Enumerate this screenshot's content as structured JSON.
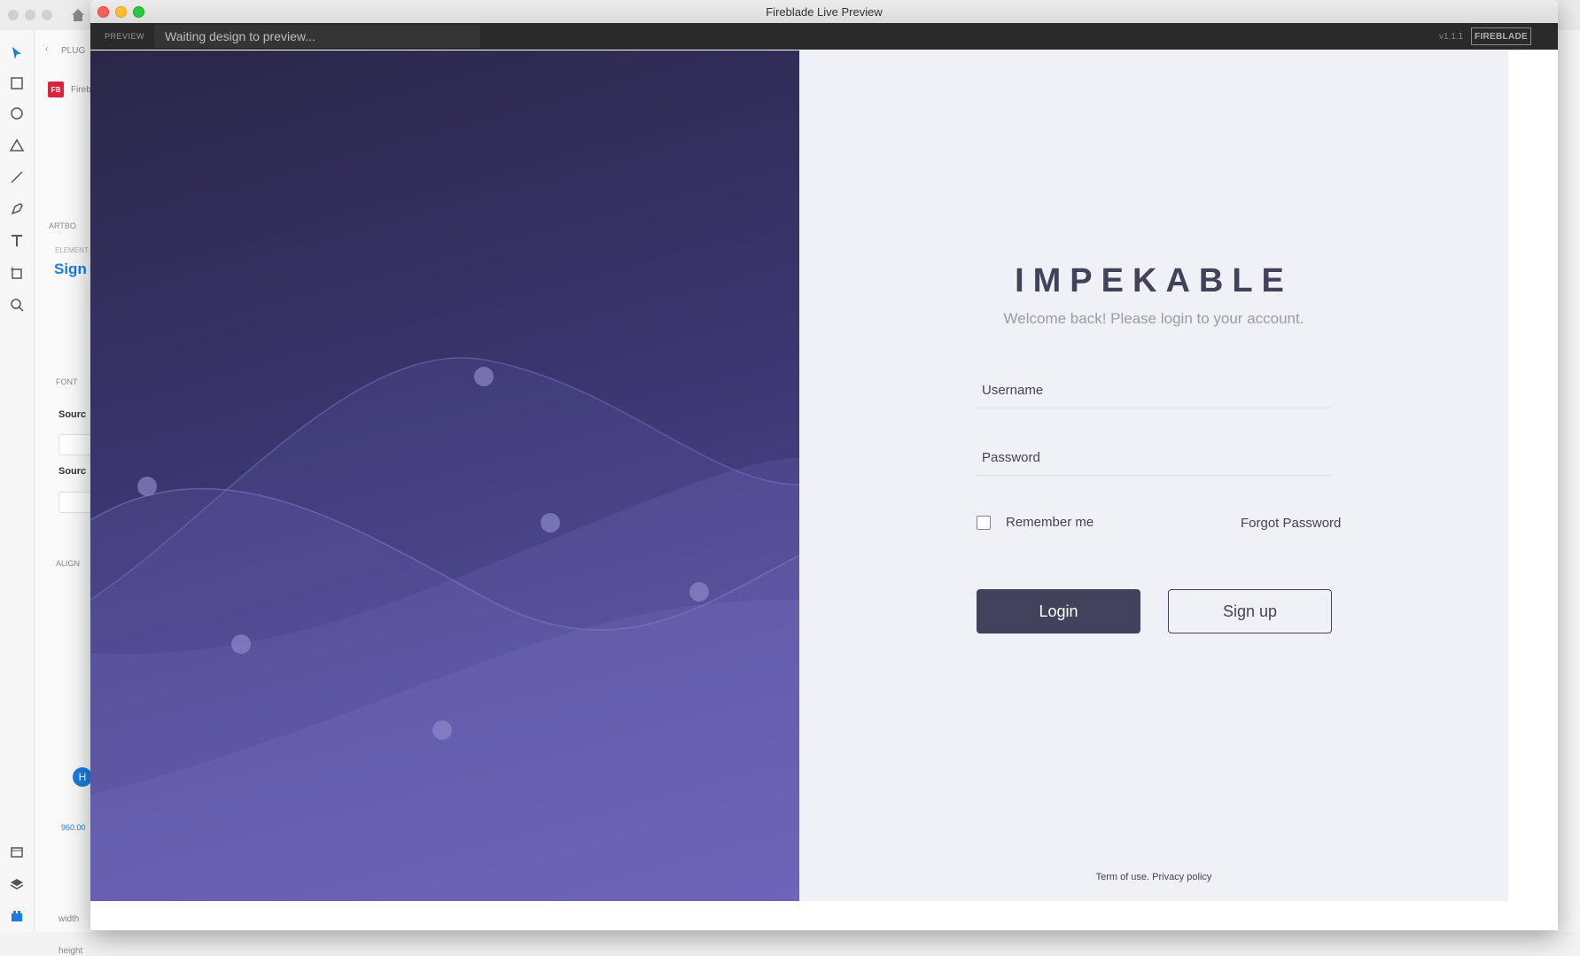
{
  "host": {
    "panel_fragments": {
      "plugins": "PLUG",
      "plugin_name": "Fireb",
      "plugin_badge": "FB",
      "artboard": "ARTBO",
      "element_label": "ELEMENT",
      "element_value": "Sign",
      "fonts": "FONT",
      "source1": "Sourc",
      "source2": "Sourc",
      "align": "ALIGN",
      "h_badge": "H",
      "h_value": "960.00",
      "width_label": "width",
      "height_label": "height"
    }
  },
  "window": {
    "title": "Fireblade Live Preview"
  },
  "preview_bar": {
    "tag": "PREVIEW",
    "status": "Waiting design to preview...",
    "version": "v1.1.1",
    "brand": "FIREBLADE"
  },
  "login": {
    "brand": "IMPEKABLE",
    "subtitle": "Welcome back! Please login to your account.",
    "username_placeholder": "Username",
    "password_placeholder": "Password",
    "remember_label": "Remember me",
    "remember_checked": false,
    "forgot_label": "Forgot Password",
    "login_button": "Login",
    "signup_button": "Sign up",
    "footer": "Term of use. Privacy policy"
  },
  "colors": {
    "primary": "#43425d",
    "hero_dark": "#2a2748",
    "hero_light": "#5c52a8",
    "pane_bg": "#f0f1f6"
  }
}
